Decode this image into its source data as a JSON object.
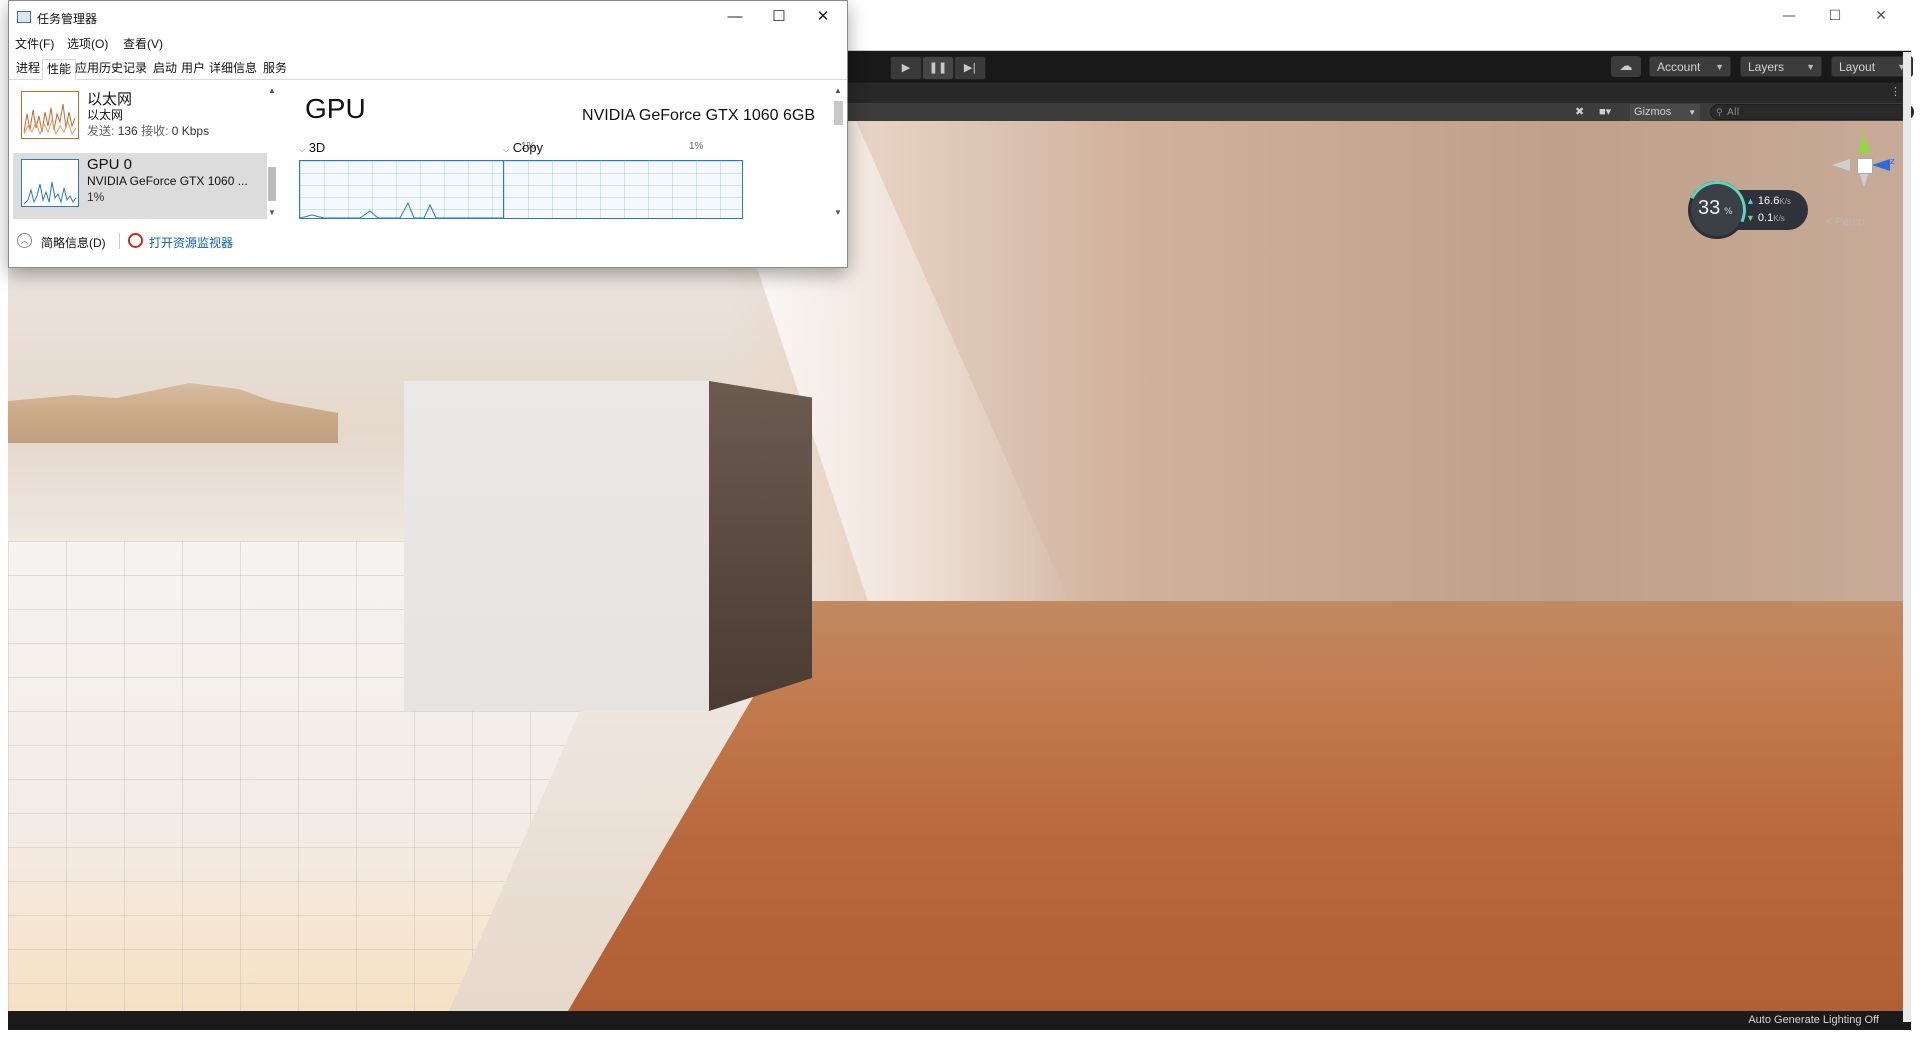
{
  "unity": {
    "window_controls": {
      "minimize": "—",
      "maximize": "☐",
      "close": "✕"
    },
    "toolbar": {
      "play": "▶",
      "pause": "❚❚",
      "step": "▶|",
      "account": "Account",
      "layers": "Layers",
      "layout": "Layout"
    },
    "scene_toolbar": {
      "gizmos": "Gizmos",
      "search_placeholder": "All"
    },
    "gizmo": {
      "y_label": "y",
      "z_label": "z",
      "projection": "< Persp"
    },
    "status_bar": {
      "text": "Auto Generate Lighting Off"
    }
  },
  "network_widget": {
    "percent": "33",
    "percent_unit": "%",
    "upload_value": "16.6",
    "upload_unit": "K/s",
    "download_value": "0.1",
    "download_unit": "K/s",
    "ring_color": "#5dd3c0"
  },
  "task_manager": {
    "title": "任务管理器",
    "window_controls": {
      "minimize": "—",
      "maximize": "☐",
      "close": "✕"
    },
    "menu": [
      "文件(F)",
      "选项(O)",
      "查看(V)"
    ],
    "tabs": [
      "进程",
      "性能",
      "应用历史记录",
      "启动",
      "用户",
      "详细信息",
      "服务"
    ],
    "active_tab": "性能",
    "resources": [
      {
        "title": "以太网",
        "subtitle": "以太网",
        "detail_send_label": "发送:",
        "detail_send": "136",
        "detail_recv_label": "接收:",
        "detail_recv": "0 Kbps",
        "color": "#c76b2b"
      },
      {
        "title": "GPU 0",
        "subtitle": "NVIDIA GeForce GTX 1060 ...",
        "detail": "1%",
        "color": "#2b78c6",
        "selected": true
      }
    ],
    "main": {
      "title": "GPU",
      "model": "NVIDIA GeForce GTX 1060 6GB",
      "engines": [
        {
          "name": "3D",
          "percent": "1%"
        },
        {
          "name": "Copy",
          "percent": "1%"
        }
      ]
    },
    "footer": {
      "brief": "简略信息(D)",
      "monitor_link": "打开资源监视器"
    }
  }
}
